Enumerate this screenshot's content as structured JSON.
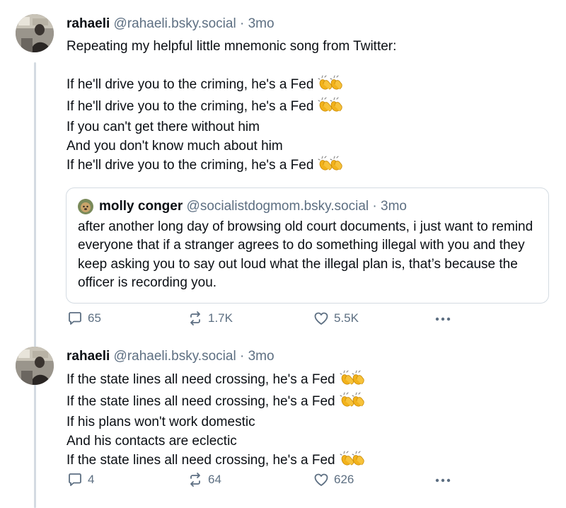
{
  "posts": [
    {
      "author": {
        "display_name": "rahaeli",
        "handle": "@rahaeli.bsky.social",
        "time": "3mo",
        "separator": "·"
      },
      "lines": [
        {
          "text": "Repeating my helpful little mnemonic song from Twitter:",
          "emoji": ""
        },
        {
          "text": "",
          "emoji": ""
        },
        {
          "text": "If he'll drive you to the criming, he's a Fed",
          "emoji": "clapping-hands"
        },
        {
          "text": "If he'll drive you to the criming, he's a Fed",
          "emoji": "clapping-hands"
        },
        {
          "text": "If you can't get there without him",
          "emoji": ""
        },
        {
          "text": "And you don't know much about him",
          "emoji": ""
        },
        {
          "text": "If he'll drive you to the criming, he's a Fed",
          "emoji": "clapping-hands"
        }
      ],
      "quote": {
        "author": {
          "display_name": "molly conger",
          "handle": "@socialistdogmom.bsky.social",
          "time": "3mo",
          "separator": "·"
        },
        "text": "after another long day of browsing old court documents, i just want to remind everyone that if a stranger agrees to do something illegal with you and they keep asking you to say out loud what the illegal plan is, that’s because the officer is recording you."
      },
      "stats": {
        "replies": "65",
        "reposts": "1.7K",
        "likes": "5.5K"
      }
    },
    {
      "author": {
        "display_name": "rahaeli",
        "handle": "@rahaeli.bsky.social",
        "time": "3mo",
        "separator": "·"
      },
      "lines": [
        {
          "text": "If the state lines all need crossing, he's a Fed",
          "emoji": "clapping-hands"
        },
        {
          "text": "If the state lines all need crossing, he's a Fed",
          "emoji": "clapping-hands"
        },
        {
          "text": "If his plans won't work domestic",
          "emoji": ""
        },
        {
          "text": "And his contacts are eclectic",
          "emoji": ""
        },
        {
          "text": "If the state lines all need crossing, he's a Fed",
          "emoji": "clapping-hands"
        }
      ],
      "stats": {
        "replies": "4",
        "reposts": "64",
        "likes": "626"
      }
    }
  ],
  "icons": {
    "reply": "speech-bubble-icon",
    "repost": "repost-arrows-icon",
    "like": "heart-icon",
    "more": "ellipsis-icon"
  },
  "colors": {
    "text": "#0b0f14",
    "muted": "#5d6f82",
    "border": "#d4dbe2",
    "background": "#ffffff"
  }
}
